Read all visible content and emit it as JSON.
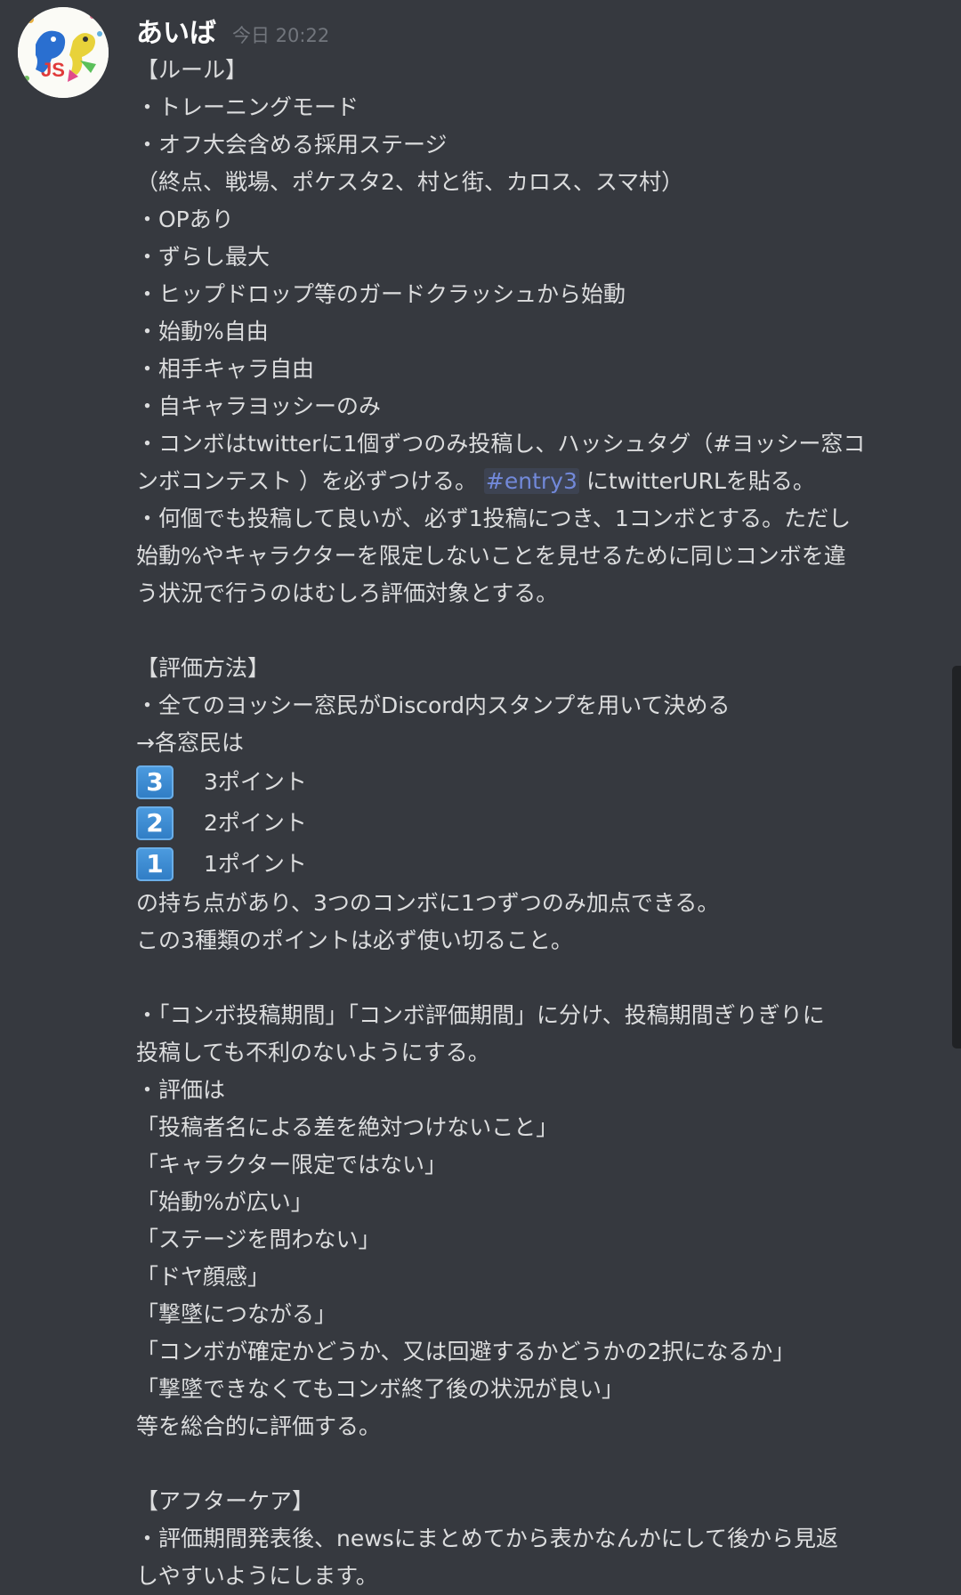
{
  "message": {
    "username": "あいば",
    "timestamp": "今日 20:22",
    "lines_a": [
      "【ルール】",
      "・トレーニングモード",
      "・オフ大会含める採用ステージ",
      "（終点、戦場、ポケスタ2、村と街、カロス、スマ村）",
      "・OPあり",
      "・ずらし最大",
      "・ヒップドロップ等のガードクラッシュから始動",
      "・始動%自由",
      "・相手キャラ自由",
      "・自キャラヨッシーのみ"
    ],
    "combo_line1": "・コンボはtwitterに1個ずつのみ投稿し、ハッシュタグ（#ヨッシー窓コ",
    "combo_line2_pre": "ンボコンテスト ）を必ずつける。",
    "mention": "#entry3",
    "combo_line2_post": "にtwitterURLを貼る。",
    "post_lines": [
      "・何個でも投稿して良いが、必ず1投稿につき、1コンボとする。ただし",
      "始動%やキャラクターを限定しないことを見せるために同じコンボを違",
      "う状況で行うのはむしろ評価対象とする。"
    ],
    "eval_lines": [
      "【評価方法】",
      "・全てのヨッシー窓民がDiscord内スタンプを用いて決める",
      "→各窓民は"
    ],
    "points": [
      {
        "emoji": "3",
        "label": "3ポイント"
      },
      {
        "emoji": "2",
        "label": "2ポイント"
      },
      {
        "emoji": "1",
        "label": "1ポイント"
      }
    ],
    "lines_c": [
      "の持ち点があり、3つのコンボに1つずつのみ加点できる。",
      "この3種類のポイントは必ず使い切ること。"
    ],
    "lines_d": [
      "・「コンボ投稿期間」「コンボ評価期間」に分け、投稿期間ぎりぎりに",
      "投稿しても不利のないようにする。",
      "・評価は",
      "「投稿者名による差を絶対つけないこと」",
      "「キャラクター限定ではない」",
      "「始動%が広い」",
      "「ステージを問わない」",
      "「ドヤ顔感」",
      "「撃墜につながる」",
      "「コンボが確定かどうか、又は回避するかどうかの2択になるか」",
      "「撃墜できなくてもコンボ終了後の状況が良い」",
      "等を総合的に評価する。"
    ],
    "lines_e": [
      "【アフターケア】",
      "・評価期間発表後、newsにまとめてから表かなんかにして後から見返",
      "しやすいようにします。"
    ]
  },
  "colors": {
    "background": "#36393f",
    "text": "#dcddde",
    "username": "#ffffff",
    "timestamp": "#72767d",
    "mention": "#7289da",
    "keycap": "#3b8ad0"
  }
}
